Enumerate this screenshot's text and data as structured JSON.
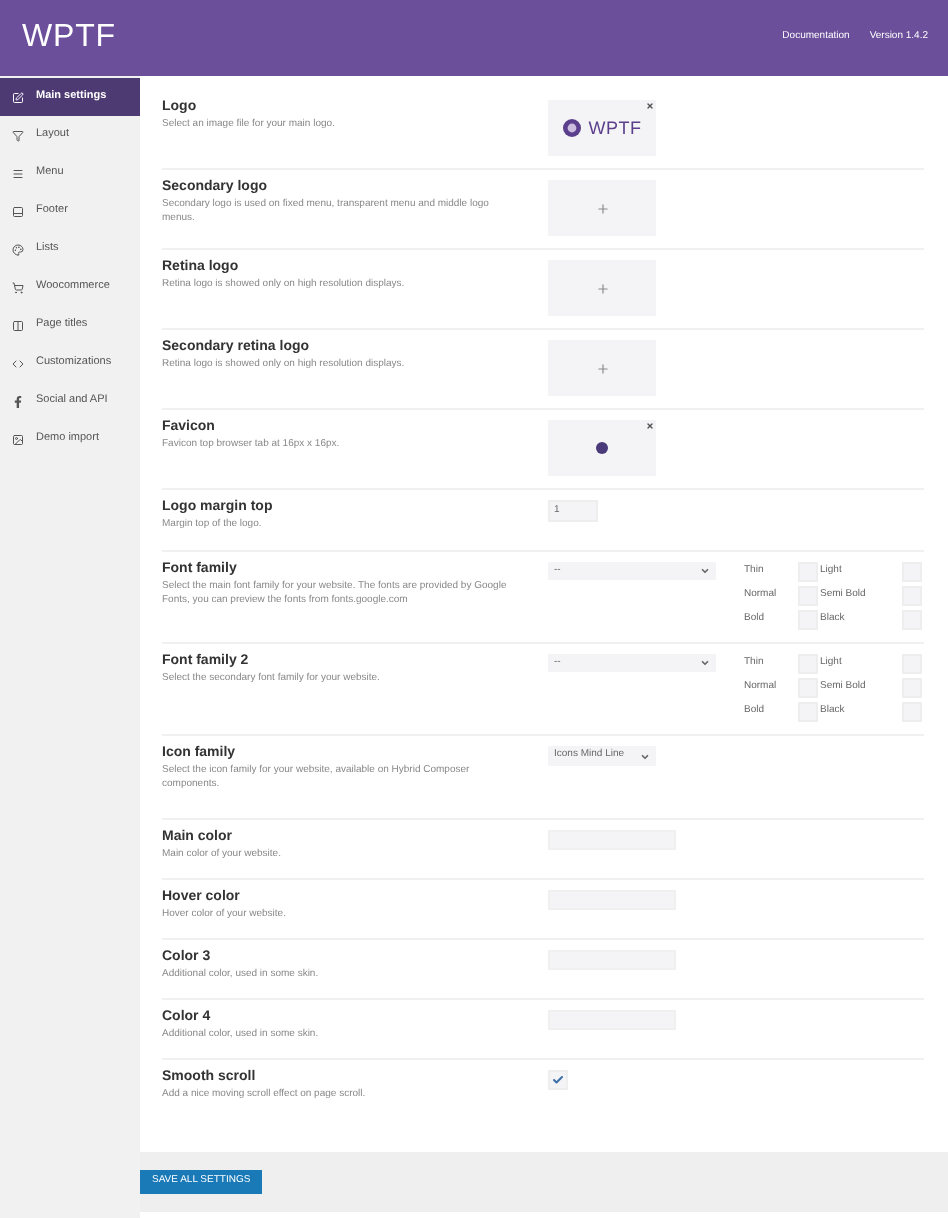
{
  "header": {
    "brand": "WPTF",
    "links": [
      "Documentation",
      "Version 1.4.2"
    ]
  },
  "sidebar": {
    "items": [
      {
        "label": "Main settings",
        "selected": true
      },
      {
        "label": "Layout",
        "selected": false
      },
      {
        "label": "Menu",
        "selected": false
      },
      {
        "label": "Footer",
        "selected": false
      },
      {
        "label": "Lists",
        "selected": false
      },
      {
        "label": "Woocommerce",
        "selected": false
      },
      {
        "label": "Page titles",
        "selected": false
      },
      {
        "label": "Customizations",
        "selected": false
      },
      {
        "label": "Social and API",
        "selected": false
      },
      {
        "label": "Demo import",
        "selected": false
      }
    ]
  },
  "settings": [
    {
      "kind": "logo_upload",
      "title": "Logo",
      "description": "Select an image file for your main logo.",
      "logo_text": "WPTF"
    },
    {
      "kind": "empty_upload",
      "title": "Secondary logo",
      "description": "Secondary logo is used on fixed menu, transparent menu and middle logo menus."
    },
    {
      "kind": "empty_upload",
      "title": "Retina logo",
      "description": "Retina logo is showed only on high resolution displays."
    },
    {
      "kind": "empty_upload",
      "title": "Secondary retina logo",
      "description": "Retina logo is showed only on high resolution displays."
    },
    {
      "kind": "favicon_upload",
      "title": "Favicon",
      "description": "Favicon top browser tab at 16px x 16px."
    },
    {
      "kind": "number",
      "title": "Logo margin top",
      "description": "Margin top of the logo.",
      "value": "1"
    },
    {
      "kind": "font",
      "title": "Font family",
      "description": "Select the main font family for your website. The fonts are provided by Google Fonts, you can preview the fonts from fonts.google.com",
      "value": "--",
      "weights": [
        {
          "label": "Thin",
          "checked": false
        },
        {
          "label": "Light",
          "checked": false
        },
        {
          "label": "Normal",
          "checked": false
        },
        {
          "label": "Semi Bold",
          "checked": false
        },
        {
          "label": "Bold",
          "checked": false
        },
        {
          "label": "Black",
          "checked": false
        }
      ]
    },
    {
      "kind": "font",
      "title": "Font family 2",
      "description": "Select the secondary font family for your website.",
      "value": "--",
      "weights": [
        {
          "label": "Thin",
          "checked": false
        },
        {
          "label": "Light",
          "checked": false
        },
        {
          "label": "Normal",
          "checked": false
        },
        {
          "label": "Semi Bold",
          "checked": false
        },
        {
          "label": "Bold",
          "checked": false
        },
        {
          "label": "Black",
          "checked": false
        }
      ]
    },
    {
      "kind": "select",
      "title": "Icon family",
      "description": "Select the icon family for your website, available on Hybrid Composer components.",
      "value": "Icons Mind Line"
    },
    {
      "kind": "color",
      "title": "Main color",
      "description": "Main color of your website."
    },
    {
      "kind": "color",
      "title": "Hover color",
      "description": "Hover color of your website."
    },
    {
      "kind": "color",
      "title": "Color 3",
      "description": "Additional color, used in some skin."
    },
    {
      "kind": "color",
      "title": "Color 4",
      "description": "Additional color, used in some skin."
    },
    {
      "kind": "checkbox",
      "title": "Smooth scroll",
      "description": "Add a nice moving scroll effect on page scroll.",
      "checked": true
    }
  ],
  "save_button": "SAVE ALL SETTINGS"
}
